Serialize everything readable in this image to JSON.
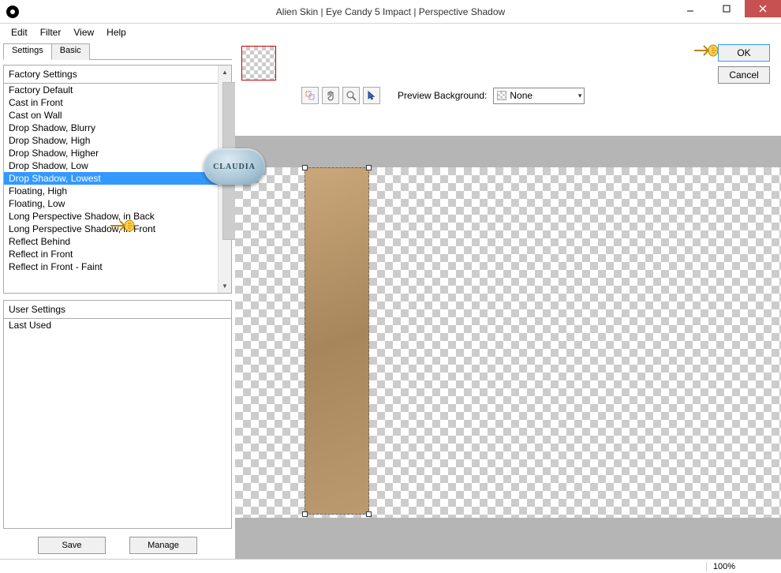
{
  "window": {
    "title": "Alien Skin | Eye Candy 5 Impact | Perspective Shadow",
    "minimize_tip": "Minimize",
    "maximize_tip": "Maximize",
    "close_tip": "Close"
  },
  "menu": {
    "items": [
      "Edit",
      "Filter",
      "View",
      "Help"
    ]
  },
  "tabs": {
    "settings": "Settings",
    "basic": "Basic",
    "active": "settings"
  },
  "factory": {
    "header": "Factory Settings",
    "items": [
      "Factory Default",
      "Cast in Front",
      "Cast on Wall",
      "Drop Shadow, Blurry",
      "Drop Shadow, High",
      "Drop Shadow, Higher",
      "Drop Shadow, Low",
      "Drop Shadow, Lowest",
      "Floating, High",
      "Floating, Low",
      "Long Perspective Shadow, in Back",
      "Long Perspective Shadow, in Front",
      "Reflect Behind",
      "Reflect in Front",
      "Reflect in Front - Faint"
    ],
    "selected_index": 7
  },
  "user": {
    "header": "User Settings",
    "items": [
      "Last Used"
    ]
  },
  "buttons": {
    "save": "Save",
    "manage": "Manage",
    "ok": "OK",
    "cancel": "Cancel"
  },
  "toolbar": {
    "preview_bg_label": "Preview Background:",
    "preview_bg_value": "None",
    "tools": [
      "selection-tool",
      "hand-tool",
      "zoom-tool",
      "pointer-tool"
    ]
  },
  "status": {
    "zoom": "100%"
  },
  "badge": "CLAUDIA"
}
